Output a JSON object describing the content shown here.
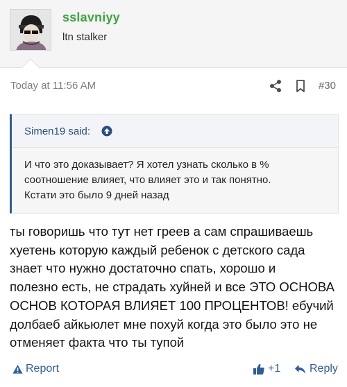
{
  "author": {
    "username": "sslavniyy",
    "title": "ltn stalker"
  },
  "post": {
    "date": "Today at 11:56 AM",
    "number": "#30"
  },
  "quote": {
    "author": "Simen19 said:",
    "lines": [
      "И что это доказывает? Я хотел узнать сколько в %",
      "соотношение влияет, что влияет это и так понятно.",
      "Кстати это было 9 дней назад"
    ]
  },
  "message": {
    "lines": [
      "ты говоришь что тут нет греев а сам спрашиваешь",
      "хуетень которую каждый ребенок с детского сада",
      "знает что нужно достаточно спать, хорошо и",
      "полезно есть, не страдать хуйней и все ЭТО ОСНОВА",
      "ОСНОВ КОТОРАЯ ВЛИЯЕТ 100 ПРОЦЕНТОВ! ебучий",
      "долбаеб айкьюлет мне похуй когда это было это не",
      "отменяет факта что ты тупой"
    ]
  },
  "actions": {
    "report": "Report",
    "like": "+1",
    "reply": "Reply"
  },
  "colors": {
    "username": "#3fa241",
    "link": "#2f5d9c",
    "quote_border": "#2f5d9c"
  },
  "icons": {
    "share": "share-icon",
    "bookmark": "bookmark-icon",
    "quote_jump": "arrow-up-circle-icon",
    "report": "warning-icon",
    "like": "thumbs-up-icon",
    "reply": "reply-arrow-icon"
  }
}
